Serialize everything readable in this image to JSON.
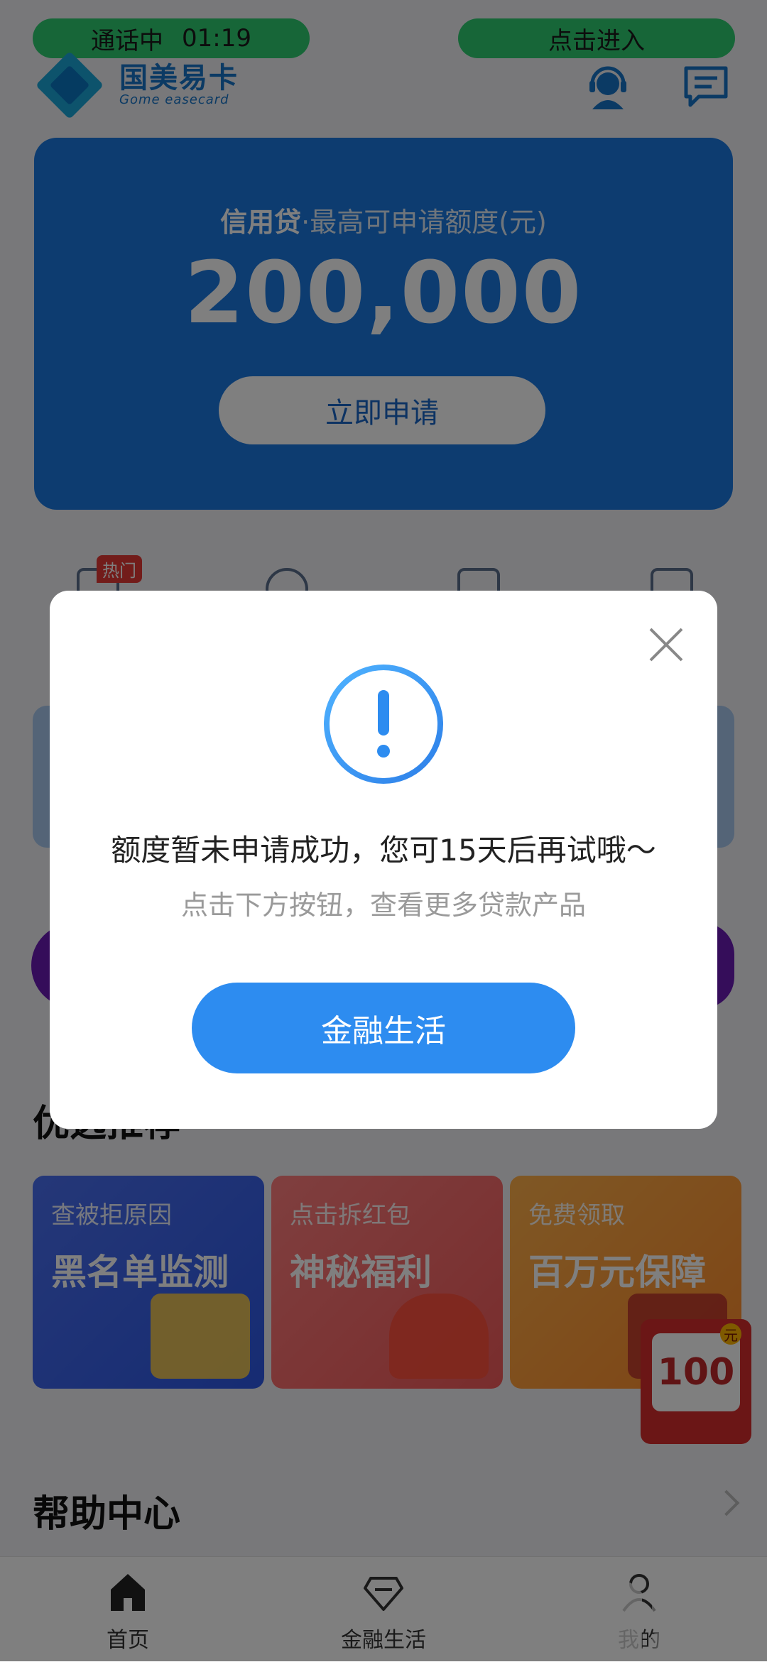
{
  "status": {
    "call_label": "通话中",
    "call_time": "01:19",
    "enter_label": "点击进入"
  },
  "header": {
    "logo_cn": "国美易卡",
    "logo_en": "Gome easecard",
    "service_icon": "customer-service-icon",
    "message_icon": "message-icon"
  },
  "hero": {
    "product": "信用贷",
    "subtitle": "·最高可申请额度(元)",
    "amount": "200,000",
    "button": "立即申请"
  },
  "quick_menu": {
    "badge": "热门"
  },
  "sections": {
    "featured_title": "优选推荐",
    "help_title": "帮助中心"
  },
  "promos": [
    {
      "tag": "查被拒原因",
      "title": "黑名单监测"
    },
    {
      "tag": "点击拆红包",
      "title": "神秘福利"
    },
    {
      "tag": "免费领取",
      "title": "百万元保障"
    }
  ],
  "coupon": {
    "value": "100",
    "unit": "元"
  },
  "tabs": [
    {
      "label": "首页",
      "icon": "home-icon"
    },
    {
      "label": "金融生活",
      "icon": "diamond-icon"
    },
    {
      "label": "我的",
      "icon": "user-icon"
    }
  ],
  "modal": {
    "title": "额度暂未申请成功，您可15天后再试哦～",
    "description": "点击下方按钮，查看更多贷款产品",
    "button": "金融生活"
  },
  "colors": {
    "accent": "#2d8cf0",
    "hero_bg": "#1a78e0",
    "status_pill": "#2ecc71"
  }
}
